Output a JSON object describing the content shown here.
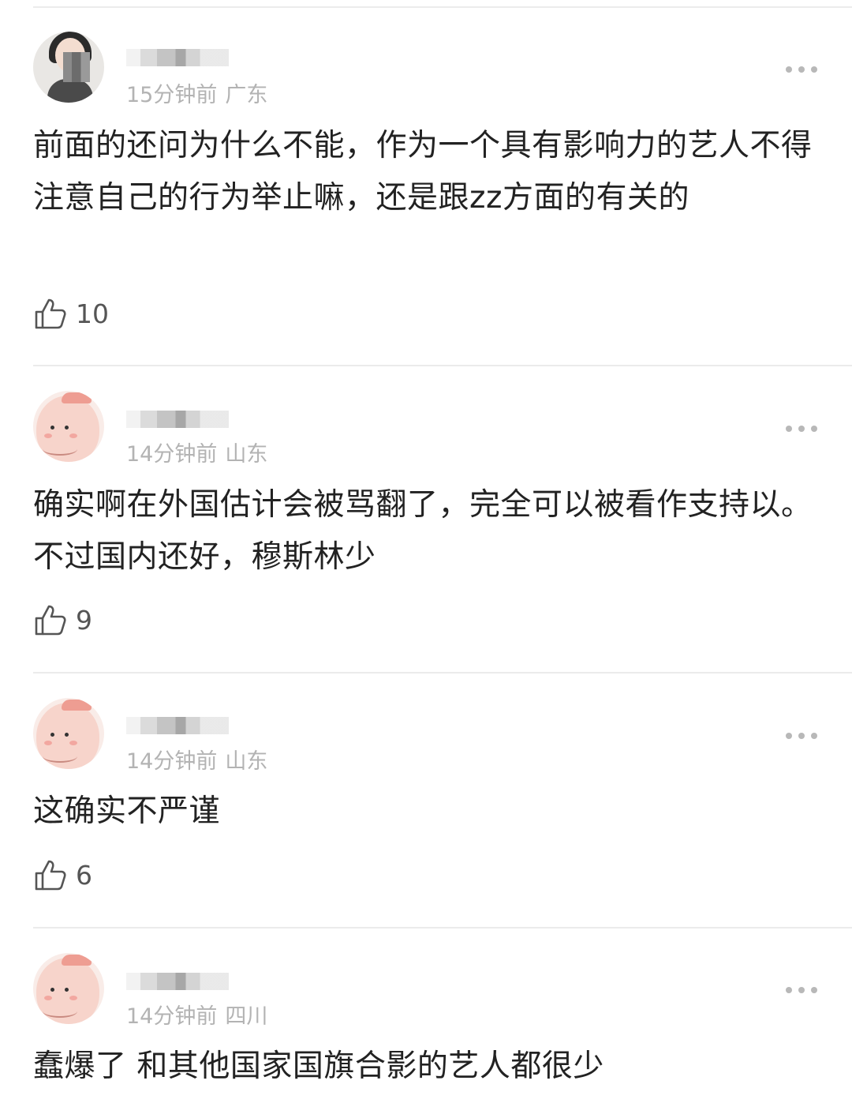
{
  "comments": [
    {
      "user": "",
      "time": "15分钟前",
      "location": "广东",
      "text": "前面的还问为什么不能，作为一个具有影响力的艺人不得注意自己的行为举止嘛，还是跟zz方面的有关的",
      "likes": "10",
      "avatar_icon": "user-photo-avatar"
    },
    {
      "user": "",
      "time": "14分钟前",
      "location": "山东",
      "text": "确实啊在外国估计会被骂翻了，完全可以被看作支持以。不过国内还好，穆斯林少",
      "likes": "9",
      "avatar_icon": "cartoon-avatar"
    },
    {
      "user": "",
      "time": "14分钟前",
      "location": "山东",
      "text": "这确实不严谨",
      "likes": "6",
      "avatar_icon": "cartoon-avatar"
    },
    {
      "user": "",
      "time": "14分钟前",
      "location": "四川",
      "text": "蠢爆了 和其他国家国旗合影的艺人都很少",
      "avatar_icon": "cartoon-avatar"
    }
  ],
  "icons": {
    "like": "thumbs-up-icon",
    "more": "more-dots-icon"
  },
  "colors": {
    "text": "#222222",
    "meta": "#b3b3b3",
    "divider": "#ebebeb"
  }
}
